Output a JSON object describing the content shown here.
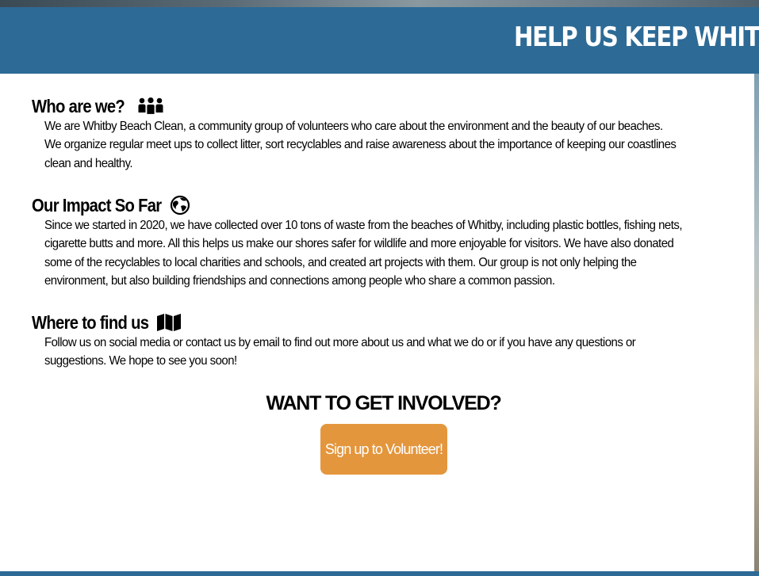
{
  "header": {
    "title": "HELP US KEEP WHITBY"
  },
  "sections": [
    {
      "heading": "Who are we?",
      "icon": "people-group-icon",
      "body": "We are Whitby Beach Clean, a community group of volunteers who care about the environment and the beauty of our beaches. We organize regular meet ups to collect litter, sort recyclables and raise awareness about the importance of keeping our coastlines clean and healthy."
    },
    {
      "heading": "Our Impact So Far",
      "icon": "earth-globe-icon",
      "body": "Since we started in 2020, we have collected over 10 tons of waste from the beaches of Whitby, including plastic bottles, fishing nets, cigarette butts and more. All this helps us make our shores safer for wildlife and more enjoyable for visitors. We have also donated some of the recyclables to local charities and schools, and created art projects with them. Our group is not only helping the environment, but also building friendships and connections among people who share a common passion."
    },
    {
      "heading": "Where to find us",
      "icon": "folded-map-icon",
      "body": "Follow us on social media or contact us by email to find out more about us and what we do or if you have any questions or suggestions. We hope to see you soon!"
    }
  ],
  "cta": {
    "heading": "WANT TO GET INVOLVED?",
    "button_label": "Sign up to Volunteer!"
  },
  "colors": {
    "header_bg": "#2d6a96",
    "button_bg": "#e4963d",
    "text": "#000000"
  }
}
